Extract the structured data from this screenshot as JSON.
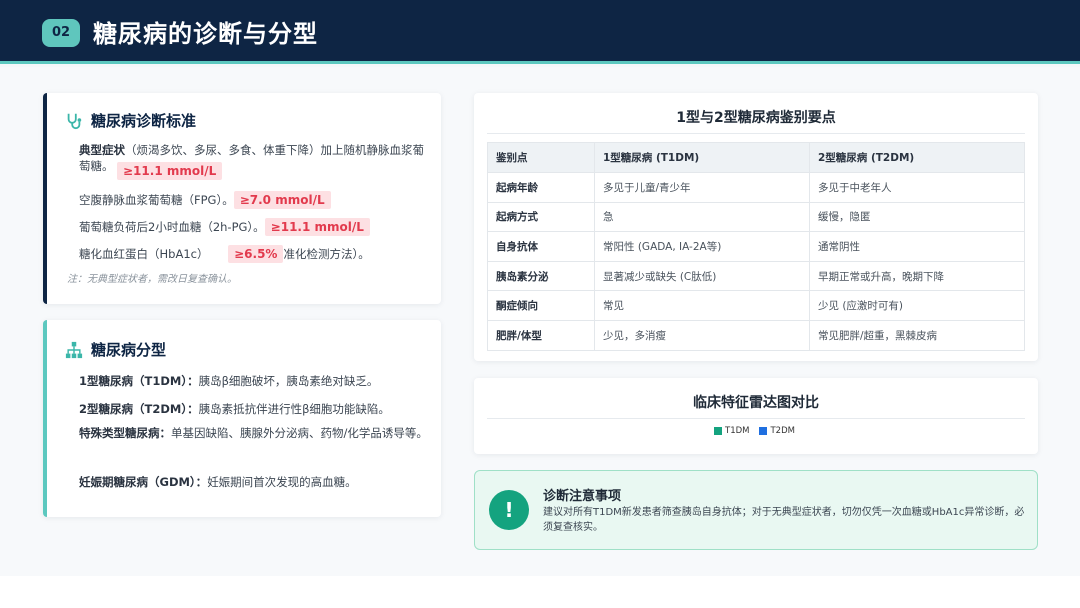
{
  "header": {
    "badge": "02",
    "title": "糖尿病的诊断与分型"
  },
  "diagnosis": {
    "title": "糖尿病诊断标准",
    "icon": "stethoscope-icon",
    "row1_label": "典型症状",
    "row1_text": "（烦渴多饮、多尿、多食、体重下降）加上随机静脉血浆葡萄糖。",
    "row1_value": "≥11.1 mmol/L",
    "row2_text": "空腹静脉血浆葡萄糖（FPG）。",
    "row2_value": "≥7.0 mmol/L",
    "row3_text": "葡萄糖负荷后2小时血糖（2h-PG）。",
    "row3_value": "≥11.1 mmol/L",
    "row4_text_a": "糖化血红蛋白（HbA1c）",
    "row4_value": "≥6.5%",
    "row4_text_b": "准化检测方法）。",
    "note": "注：无典型症状者，需改日复查确认。"
  },
  "typing": {
    "title": "糖尿病分型",
    "icon": "hierarchy-icon",
    "items": [
      {
        "label": "1型糖尿病（T1DM）：",
        "text": "胰岛β细胞破坏，胰岛素绝对缺乏。"
      },
      {
        "label": "2型糖尿病（T2DM）：",
        "text": "胰岛素抵抗伴进行性β细胞功能缺陷。"
      },
      {
        "label": "特殊类型糖尿病：",
        "text": "单基因缺陷、胰腺外分泌病、药物/化学品诱导等。"
      },
      {
        "label": "妊娠期糖尿病（GDM）：",
        "text": "妊娠期间首次发现的高血糖。"
      }
    ]
  },
  "comparison": {
    "title": "1型与2型糖尿病鉴别要点",
    "headers": [
      "鉴别点",
      "1型糖尿病 (T1DM)",
      "2型糖尿病 (T2DM)"
    ],
    "rows": [
      [
        "起病年龄",
        "多见于儿童/青少年",
        "多见于中老年人"
      ],
      [
        "起病方式",
        "急",
        "缓慢，隐匿"
      ],
      [
        "自身抗体",
        "常阳性 (GADA, IA-2A等)",
        "通常阴性"
      ],
      [
        "胰岛素分泌",
        "显著减少或缺失 (C肽低)",
        "早期正常或升高，晚期下降"
      ],
      [
        "酮症倾向",
        "常见",
        "少见 (应激时可有)"
      ],
      [
        "肥胖/体型",
        "少见，多消瘦",
        "常见肥胖/超重，黑棘皮病"
      ]
    ]
  },
  "radar": {
    "title": "临床特征雷达图对比",
    "legend": [
      {
        "name": "T1DM",
        "color": "#14a37f"
      },
      {
        "name": "T2DM",
        "color": "#1f6fe0"
      }
    ]
  },
  "notice": {
    "icon": "alert-icon",
    "icon_glyph": "!",
    "title": "诊断注意事项",
    "body": "建议对所有T1DM新发患者筛查胰岛自身抗体；对于无典型症状者，切勿仅凭一次血糖或HbA1c异常诊断，必须复查核实。"
  }
}
